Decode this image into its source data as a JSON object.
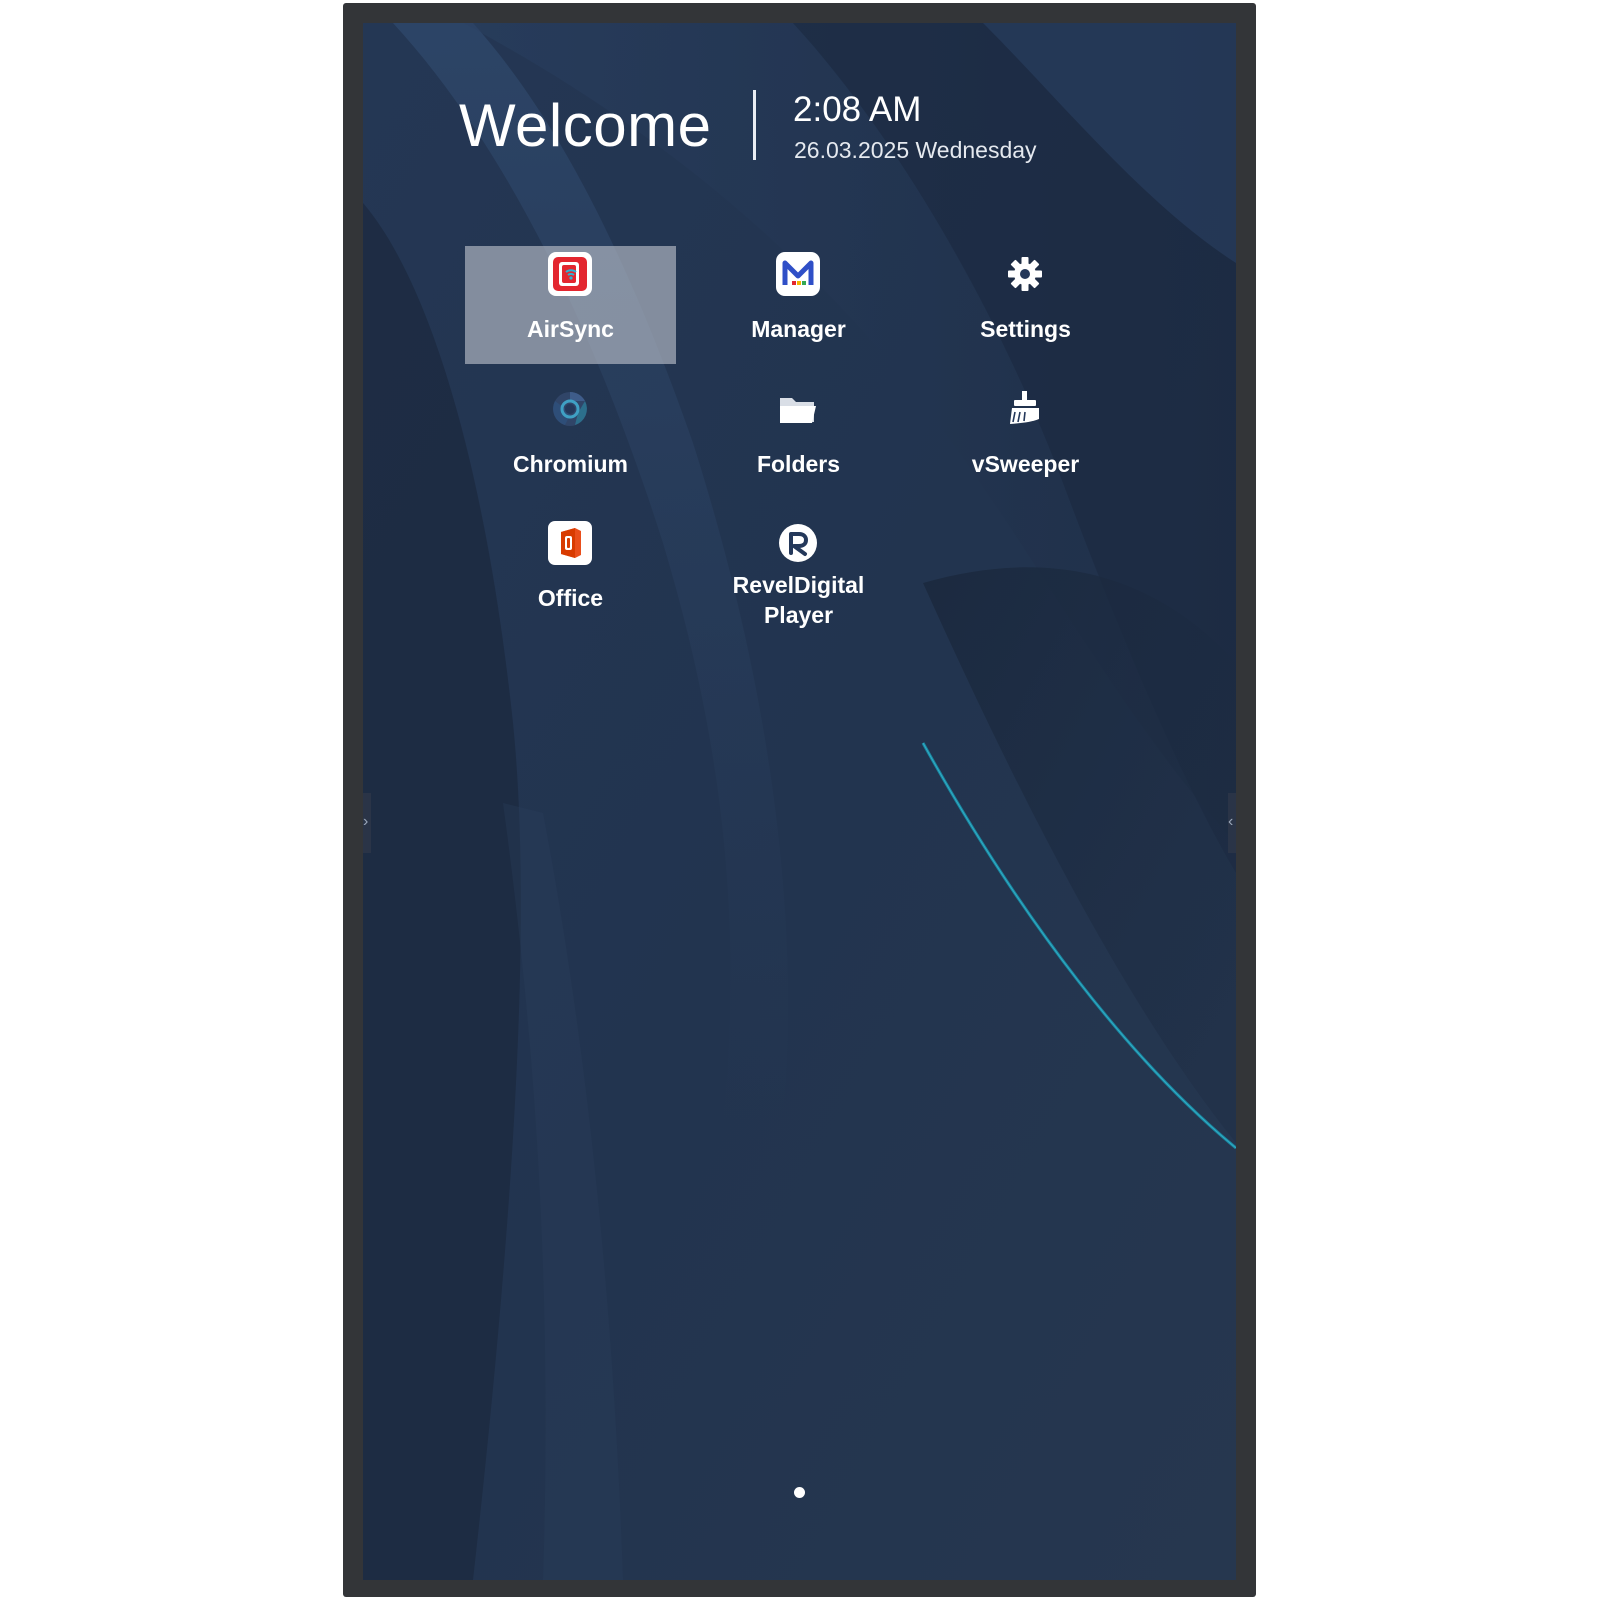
{
  "header": {
    "greeting": "Welcome",
    "time": "2:08 AM",
    "date": "26.03.2025 Wednesday"
  },
  "apps": [
    {
      "id": "airsync",
      "label": "AirSync",
      "icon": "airsync-icon",
      "selected": true
    },
    {
      "id": "manager",
      "label": "Manager",
      "icon": "manager-icon",
      "selected": false
    },
    {
      "id": "settings",
      "label": "Settings",
      "icon": "gear-icon",
      "selected": false
    },
    {
      "id": "chromium",
      "label": "Chromium",
      "icon": "chromium-icon",
      "selected": false
    },
    {
      "id": "folders",
      "label": "Folders",
      "icon": "folder-icon",
      "selected": false
    },
    {
      "id": "vsweeper",
      "label": "vSweeper",
      "icon": "broom-icon",
      "selected": false
    },
    {
      "id": "office",
      "label": "Office",
      "icon": "office-icon",
      "selected": false
    },
    {
      "id": "reveldigital",
      "label": "RevelDigital\nPlayer",
      "icon": "reveldigital-icon",
      "selected": false
    }
  ],
  "edge_handles": {
    "left": "›",
    "right": "‹"
  },
  "pager": {
    "pages": 1,
    "current": 1
  },
  "colors": {
    "wallpaper_base": "#22344f",
    "wallpaper_dark": "#1b2a40",
    "accent_teal": "#1a8fa8",
    "selection": "#bec4cd",
    "bezel": "#333538"
  }
}
